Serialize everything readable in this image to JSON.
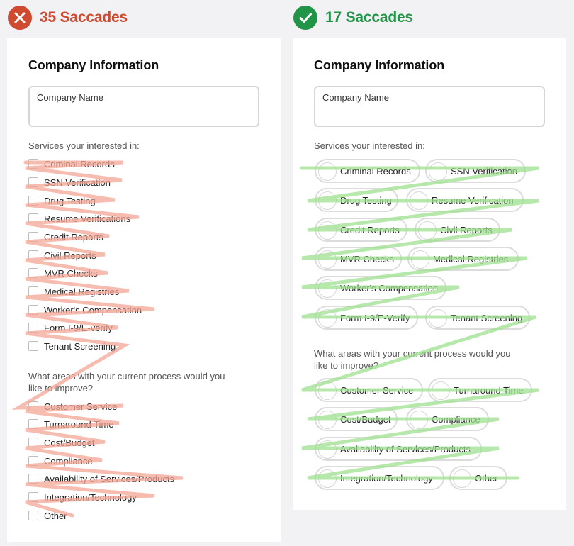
{
  "colors": {
    "bad": "#cf4a2f",
    "good": "#229447",
    "bad_stroke": "#f2a99a",
    "good_stroke": "#9fe08f"
  },
  "left": {
    "status_icon": "close-icon",
    "heading": "35 Saccades",
    "form": {
      "title": "Company Information",
      "company_name_placeholder": "Company Name",
      "services_label": "Services your interested in:",
      "services": [
        "Criminal Records",
        "SSN Verification",
        "Drug Testing",
        "Resume Verifications",
        "Credit Reports",
        "Civil Reports",
        "MVR Checks",
        "Medical Registries",
        "Worker's Compensation",
        "Form I-9/E-verify",
        "Tenant Screening"
      ],
      "improve_label_line1": "What areas with your current process would you",
      "improve_label_line2": "like to improve?",
      "improve": [
        "Customer Service",
        "Turnaround Time",
        "Cost/Budget",
        "Compliance",
        "Availability of Services/Products",
        "Integration/Technology",
        "Other"
      ]
    }
  },
  "right": {
    "status_icon": "check-icon",
    "heading": "17 Saccades",
    "form": {
      "title": "Company Information",
      "company_name_placeholder": "Company Name",
      "services_label": "Services your interested in:",
      "services": [
        "Criminal Records",
        "SSN Verification",
        "Drug Testing",
        "Resume Verification",
        "Credit Reports",
        "Civil Reports",
        "MVR Checks",
        "Medical Registries",
        "Worker's Compensation",
        "Form I-9/E-Verify",
        "Tenant Screening"
      ],
      "improve_label_line1": "What areas with your current process would you",
      "improve_label_line2": "like to improve?",
      "improve": [
        "Customer Service",
        "Turnaround Time",
        "Cost/Budget",
        "Compliance",
        "Availability of Services/Products",
        "Integration/Technology",
        "Other"
      ]
    }
  }
}
